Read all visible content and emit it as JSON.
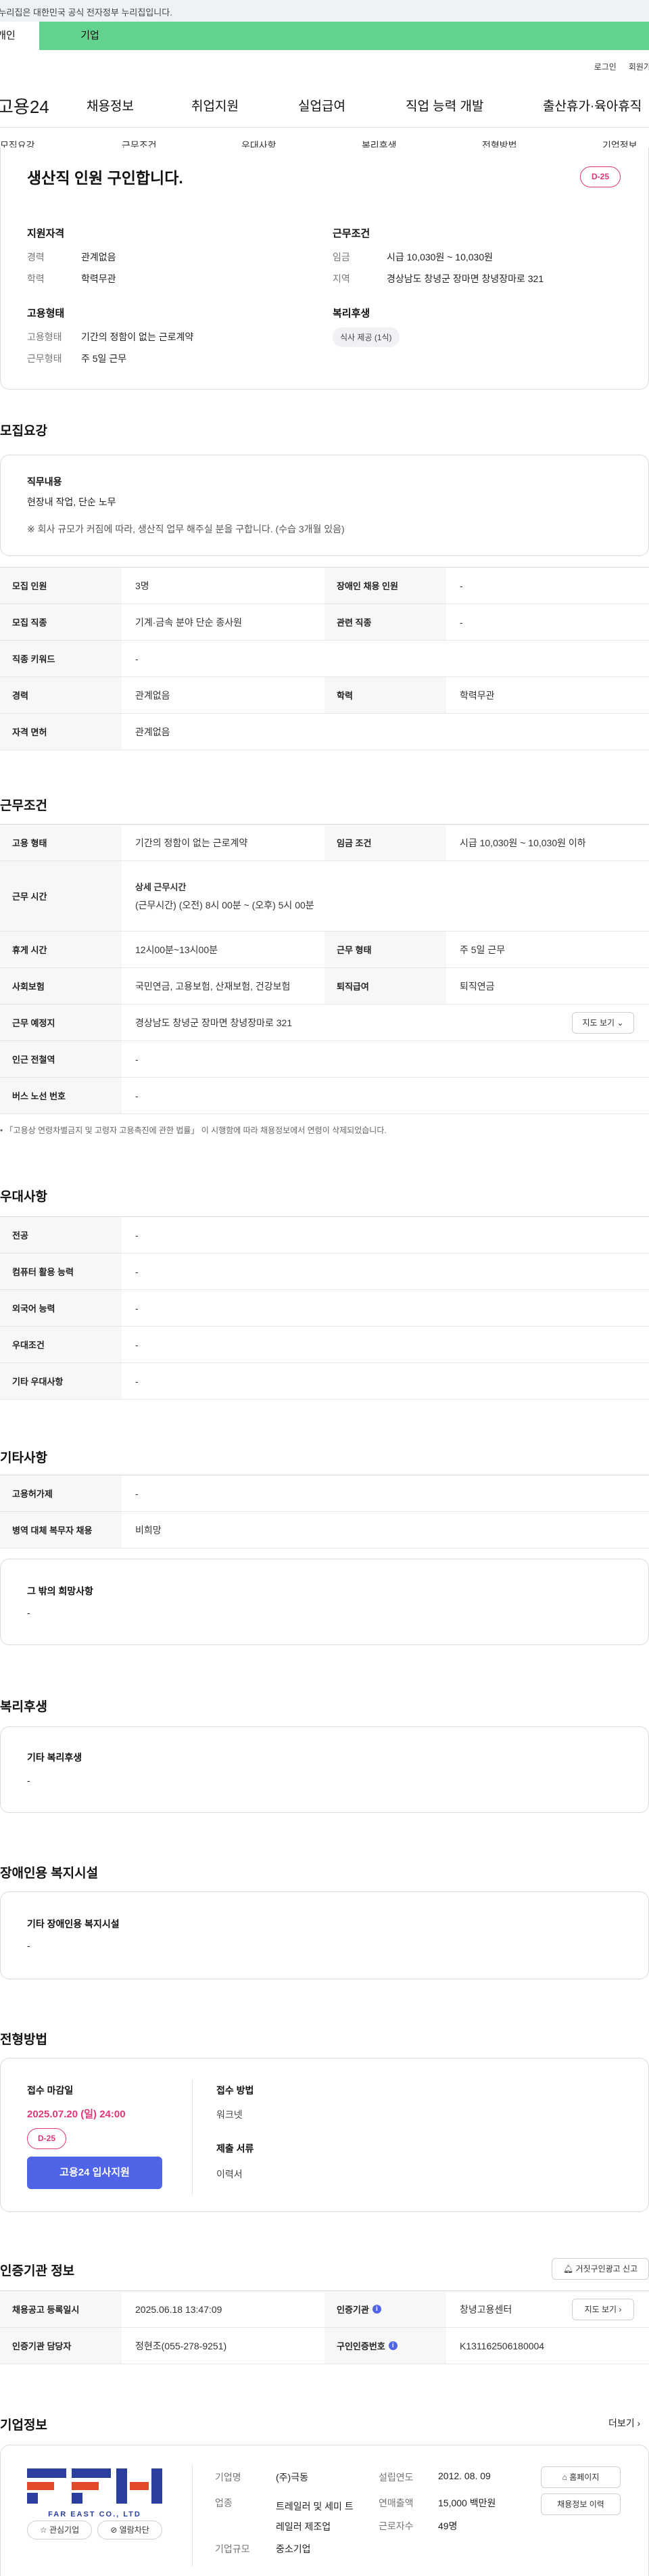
{
  "gov_banner": "이 누리집은 대한민국 공식 전자정부 누리집입니다.",
  "user_tabs": [
    "개인",
    "기업"
  ],
  "util": [
    "로그인",
    "회원가입"
  ],
  "brand": "고용24",
  "gnb": [
    "채용정보",
    "취업지원",
    "실업급여",
    "직업 능력 개발",
    "출산휴가·육아휴직"
  ],
  "snb": [
    "모집요강",
    "근무조건",
    "우대사항",
    "복리후생",
    "전형방법",
    "기업정보"
  ],
  "summary": {
    "title": "생산직 인원 구인합니다.",
    "dday": "D-25",
    "qual_title": "지원자격",
    "qual": [
      {
        "k": "경력",
        "v": "관계없음"
      },
      {
        "k": "학력",
        "v": "학력무관"
      }
    ],
    "work_title": "근무조건",
    "work": [
      {
        "k": "임금",
        "v": "시급 10,030원 ~ 10,030원"
      },
      {
        "k": "지역",
        "v": "경상남도 창녕군 장마면 창녕장마로 321"
      }
    ],
    "emp_title": "고용형태",
    "emp": [
      {
        "k": "고용형태",
        "v": "기간의 정함이 없는 근로계약"
      },
      {
        "k": "근무형태",
        "v": "주 5일 근무"
      }
    ],
    "welfare_title": "복리후생",
    "welfare_chip": "식사 제공 (1식)"
  },
  "recruit": {
    "heading": "모집요강",
    "duty_title": "직무내용",
    "duty_text": "현장내 작업, 단순 노무",
    "duty_note": "※ 회사 규모가 커짐에 따라, 생산직 업무 해주실 분을 구합니다. (수습 3개월 있음)",
    "rows": [
      {
        "k1": "모집 인원",
        "v1": "3명",
        "k2": "장애인 채용 인원",
        "v2": "-"
      },
      {
        "k1": "모집 직종",
        "v1": "기계·금속 분야 단순 종사원",
        "k2": "관련 직종",
        "v2": "-"
      },
      {
        "k1": "직종 키워드",
        "v1": "-"
      },
      {
        "k1": "경력",
        "v1": "관계없음",
        "k2": "학력",
        "v2": "학력무관"
      },
      {
        "k1": "자격 면허",
        "v1": "관계없음"
      }
    ]
  },
  "cond": {
    "heading": "근무조건",
    "r1": {
      "k1": "고용 형태",
      "v1": "기간의 정함이 없는 근로계약",
      "k2": "임금 조건",
      "v2": "시급 10,030원 ~ 10,030원 이하"
    },
    "r2": {
      "k": "근무 시간",
      "sub": "상세 근무시간",
      "v": "(근무시간) (오전) 8시 00분 ~ (오후) 5시 00분"
    },
    "r3": {
      "k1": "휴게 시간",
      "v1": "12시00분~13시00분",
      "k2": "근무 형태",
      "v2": "주 5일 근무"
    },
    "r4": {
      "k1": "사회보험",
      "v1": "국민연금, 고용보험, 산재보험, 건강보험",
      "k2": "퇴직급여",
      "v2": "퇴직연금"
    },
    "r5": {
      "k": "근무 예정지",
      "v": "경상남도 창녕군 장마면 창녕장마로 321",
      "btn": "지도 보기"
    },
    "r6": {
      "k": "인근 전철역",
      "v": "-"
    },
    "r7": {
      "k": "버스 노선 번호",
      "v": "-"
    },
    "note": "「고용상 연령차별금지 및 고령자 고용촉진에 관한 법률」 이 시행함에 따라 채용정보에서 연령이 삭제되었습니다."
  },
  "pref": {
    "heading": "우대사항",
    "rows": [
      {
        "k": "전공",
        "v": "-"
      },
      {
        "k": "컴퓨터 활용 능력",
        "v": "-"
      },
      {
        "k": "외국어 능력",
        "v": "-"
      },
      {
        "k": "우대조건",
        "v": "-"
      },
      {
        "k": "기타 우대사항",
        "v": "-"
      }
    ]
  },
  "etc": {
    "heading": "기타사항",
    "rows": [
      {
        "k": "고용허가제",
        "v": "-"
      },
      {
        "k": "병역 대체 복무자 채용",
        "v": "비희망"
      }
    ],
    "box_title": "그 밖의 희망사항",
    "box_val": "-"
  },
  "benefit": {
    "heading": "복리후생",
    "box_title": "기타 복리후생",
    "box_val": "-"
  },
  "disab": {
    "heading": "장애인용 복지시설",
    "box_title": "기타 장애인용 복지시설",
    "box_val": "-"
  },
  "process": {
    "heading": "전형방법",
    "deadline_label": "접수 마감일",
    "deadline": "2025.07.20 (일) 24:00",
    "dday": "D-25",
    "apply": "고용24 입사지원",
    "method_label": "접수 방법",
    "method": "워크넷",
    "docs_label": "제출 서류",
    "docs": "이력서"
  },
  "agency": {
    "heading": "인증기관 정보",
    "report": "거짓구인광고 신고",
    "r1": {
      "k1": "채용공고 등록일시",
      "v1": "2025.06.18 13:47:09",
      "k2": "인증기관",
      "v2": "창녕고용센터",
      "btn": "지도 보기"
    },
    "r2": {
      "k1": "인증기관 담당자",
      "v1": "정현조(055-278-9251)",
      "k2": "구인인증번호",
      "v2": "K131162506180004"
    }
  },
  "company": {
    "heading": "기업정보",
    "more": "더보기",
    "logo_text": "FAR EAST CO., LTD",
    "fav": "관심기업",
    "block": "열람차단",
    "info": [
      {
        "k": "기업명",
        "v": "(주)극동"
      },
      {
        "k": "업종",
        "v": "트레일러 및 세미 트레일러 제조업"
      },
      {
        "k": "기업규모",
        "v": "중소기업"
      }
    ],
    "info2": [
      {
        "k": "설립연도",
        "v": "2012. 08. 09"
      },
      {
        "k": "연매출액",
        "v": "15,000 백만원"
      },
      {
        "k": "근로자수",
        "v": "49명"
      }
    ],
    "homepage": "홈페이지",
    "history": "채용정보 이력"
  },
  "colors": {
    "accent": "#4f64e6",
    "dday": "#e0357a",
    "tabs": "#63d28f"
  }
}
